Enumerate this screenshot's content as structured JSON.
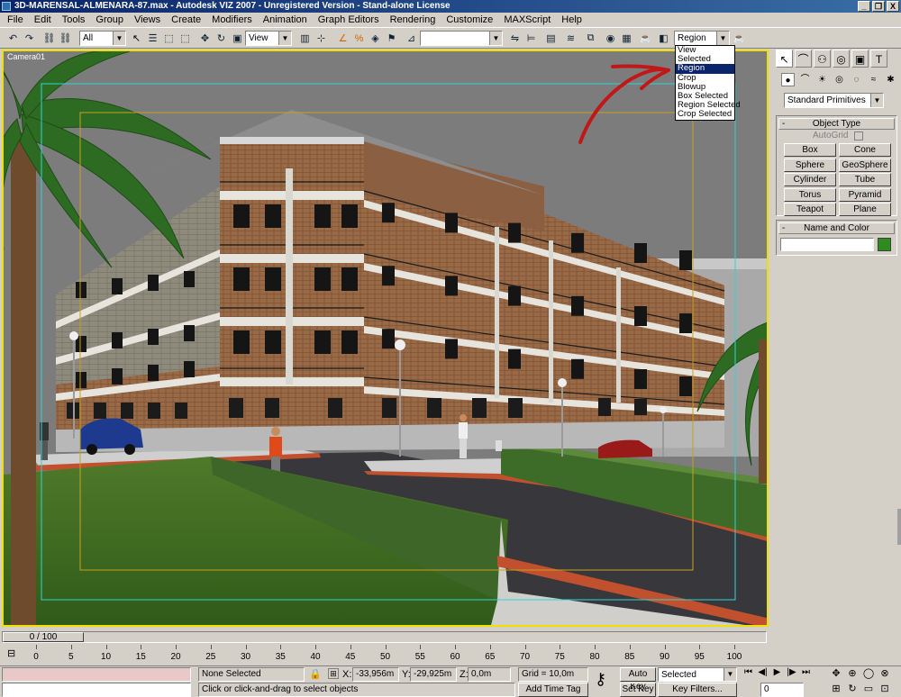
{
  "window": {
    "title": "3D-MARENSAL-ALMENARA-87.max - Autodesk VIZ 2007 - Unregistered Version - Stand-alone License",
    "controls": [
      "_",
      "❐",
      "X"
    ]
  },
  "menu": [
    "File",
    "Edit",
    "Tools",
    "Group",
    "Views",
    "Create",
    "Modifiers",
    "Animation",
    "Graph Editors",
    "Rendering",
    "Customize",
    "MAXScript",
    "Help"
  ],
  "toolbar": {
    "selection_filter": "All",
    "reference_coord": "View",
    "named_selection": "",
    "render_type": "Region",
    "icons": {
      "undo": "↶",
      "redo": "↷",
      "link": "⛓",
      "unlink": "⛓",
      "select": "↖",
      "select_name": "☰",
      "rect_region": "⬚",
      "window_crossing": "⬚",
      "move": "✥",
      "rotate": "↻",
      "scale": "▣",
      "mirror": "⇋",
      "align": "⊨",
      "layer": "▤",
      "curve": "≋",
      "schematic": "⧉",
      "material": "◉",
      "render": "☕",
      "quick_render": "☕"
    }
  },
  "render_dropdown": {
    "options": [
      "View",
      "Selected",
      "Region",
      "Crop",
      "Blowup",
      "Box Selected",
      "Region Selected",
      "Crop Selected"
    ],
    "selected": "Region"
  },
  "viewport": {
    "label": "Camera01"
  },
  "command_panel": {
    "tabs": [
      "↖",
      "⌒",
      "⚇",
      "◎",
      "▣",
      "T"
    ],
    "sub_icons": [
      "●",
      "⌒",
      "☀",
      "◎",
      "◌",
      "≈",
      "✱"
    ],
    "category": "Standard Primitives",
    "object_type": {
      "header": "Object Type",
      "autogrid": "AutoGrid",
      "buttons": [
        "Box",
        "Cone",
        "Sphere",
        "GeoSphere",
        "Cylinder",
        "Tube",
        "Torus",
        "Pyramid",
        "Teapot",
        "Plane"
      ]
    },
    "name_color": {
      "header": "Name and Color",
      "name": "",
      "color": "#2e8b1e"
    }
  },
  "timeline": {
    "frame_counter": "0 / 100",
    "ticks": [
      "0",
      "5",
      "10",
      "15",
      "20",
      "25",
      "30",
      "35",
      "40",
      "45",
      "50",
      "55",
      "60",
      "65",
      "70",
      "75",
      "80",
      "85",
      "90",
      "95",
      "100"
    ]
  },
  "status": {
    "selection": "None Selected",
    "prompt": "Click or click-and-drag to select objects",
    "x_label": "X:",
    "x": "-33,956m",
    "y_label": "Y:",
    "y": "-29,925m",
    "z_label": "Z:",
    "z": "0,0m",
    "grid": "Grid = 10,0m",
    "add_time_tag": "Add Time Tag",
    "auto_key": "Auto Key",
    "set_key": "Set Key",
    "key_mode": "Selected",
    "key_filters": "Key Filters...",
    "current_frame": "0",
    "playback_icons": [
      "⏮",
      "◀|",
      "▶",
      "|▶",
      "⏭"
    ],
    "nav_icons": [
      "✥",
      "⊕",
      "◯",
      "⊗",
      "⊞",
      "↻",
      "▭",
      "⊡"
    ]
  }
}
